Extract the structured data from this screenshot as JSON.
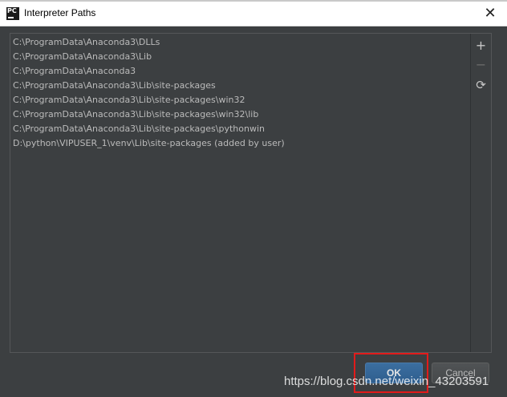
{
  "window": {
    "app_icon_text": "PC",
    "title": "Interpreter Paths",
    "close_glyph": "✕"
  },
  "paths": [
    "C:\\ProgramData\\Anaconda3\\DLLs",
    "C:\\ProgramData\\Anaconda3\\Lib",
    "C:\\ProgramData\\Anaconda3",
    "C:\\ProgramData\\Anaconda3\\Lib\\site-packages",
    "C:\\ProgramData\\Anaconda3\\Lib\\site-packages\\win32",
    "C:\\ProgramData\\Anaconda3\\Lib\\site-packages\\win32\\lib",
    "C:\\ProgramData\\Anaconda3\\Lib\\site-packages\\pythonwin",
    "D:\\python\\VIPUSER_1\\venv\\Lib\\site-packages  (added by user)"
  ],
  "toolbar": {
    "add_glyph": "+",
    "remove_glyph": "−",
    "reload_glyph": "⟳"
  },
  "buttons": {
    "ok": "OK",
    "cancel": "Cancel"
  },
  "watermark": "https://blog.csdn.net/weixin_43203591",
  "colors": {
    "dialog_bg": "#3c3f41",
    "text": "#bbbbbb",
    "ok_bg": "#365f8a",
    "highlight": "#e21b1b"
  }
}
